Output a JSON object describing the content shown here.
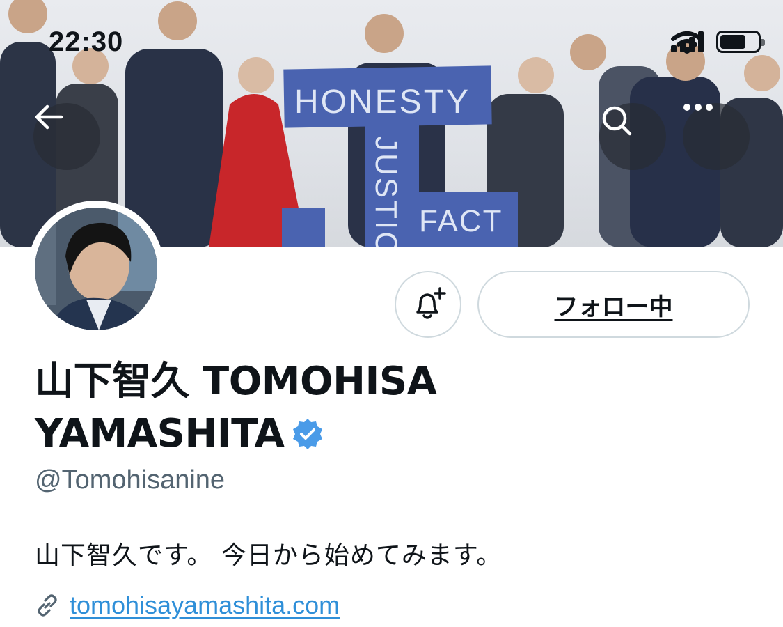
{
  "status_bar": {
    "time": "22:30"
  },
  "banner": {
    "signs": [
      "HONESTY",
      "JUSTICE",
      "FACT"
    ]
  },
  "header_buttons": {
    "back_icon": "arrow-left-icon",
    "search_icon": "search-icon",
    "more_icon": "more-horizontal-icon"
  },
  "actions": {
    "notification_icon": "bell-plus-icon",
    "follow_label": "フォロー中"
  },
  "profile": {
    "name_line1": "山下智久 TOMOHISA",
    "name_line2": "YAMASHITA",
    "verified": true,
    "handle": "@Tomohisanine",
    "bio": "山下智久です。 今日から始めてみます。",
    "link_icon": "link-icon",
    "website": "tomohisayamashita.com"
  },
  "colors": {
    "link": "#2f8fd8",
    "verified_badge": "#1d9bf0",
    "sign_blue": "#4a63b0"
  }
}
